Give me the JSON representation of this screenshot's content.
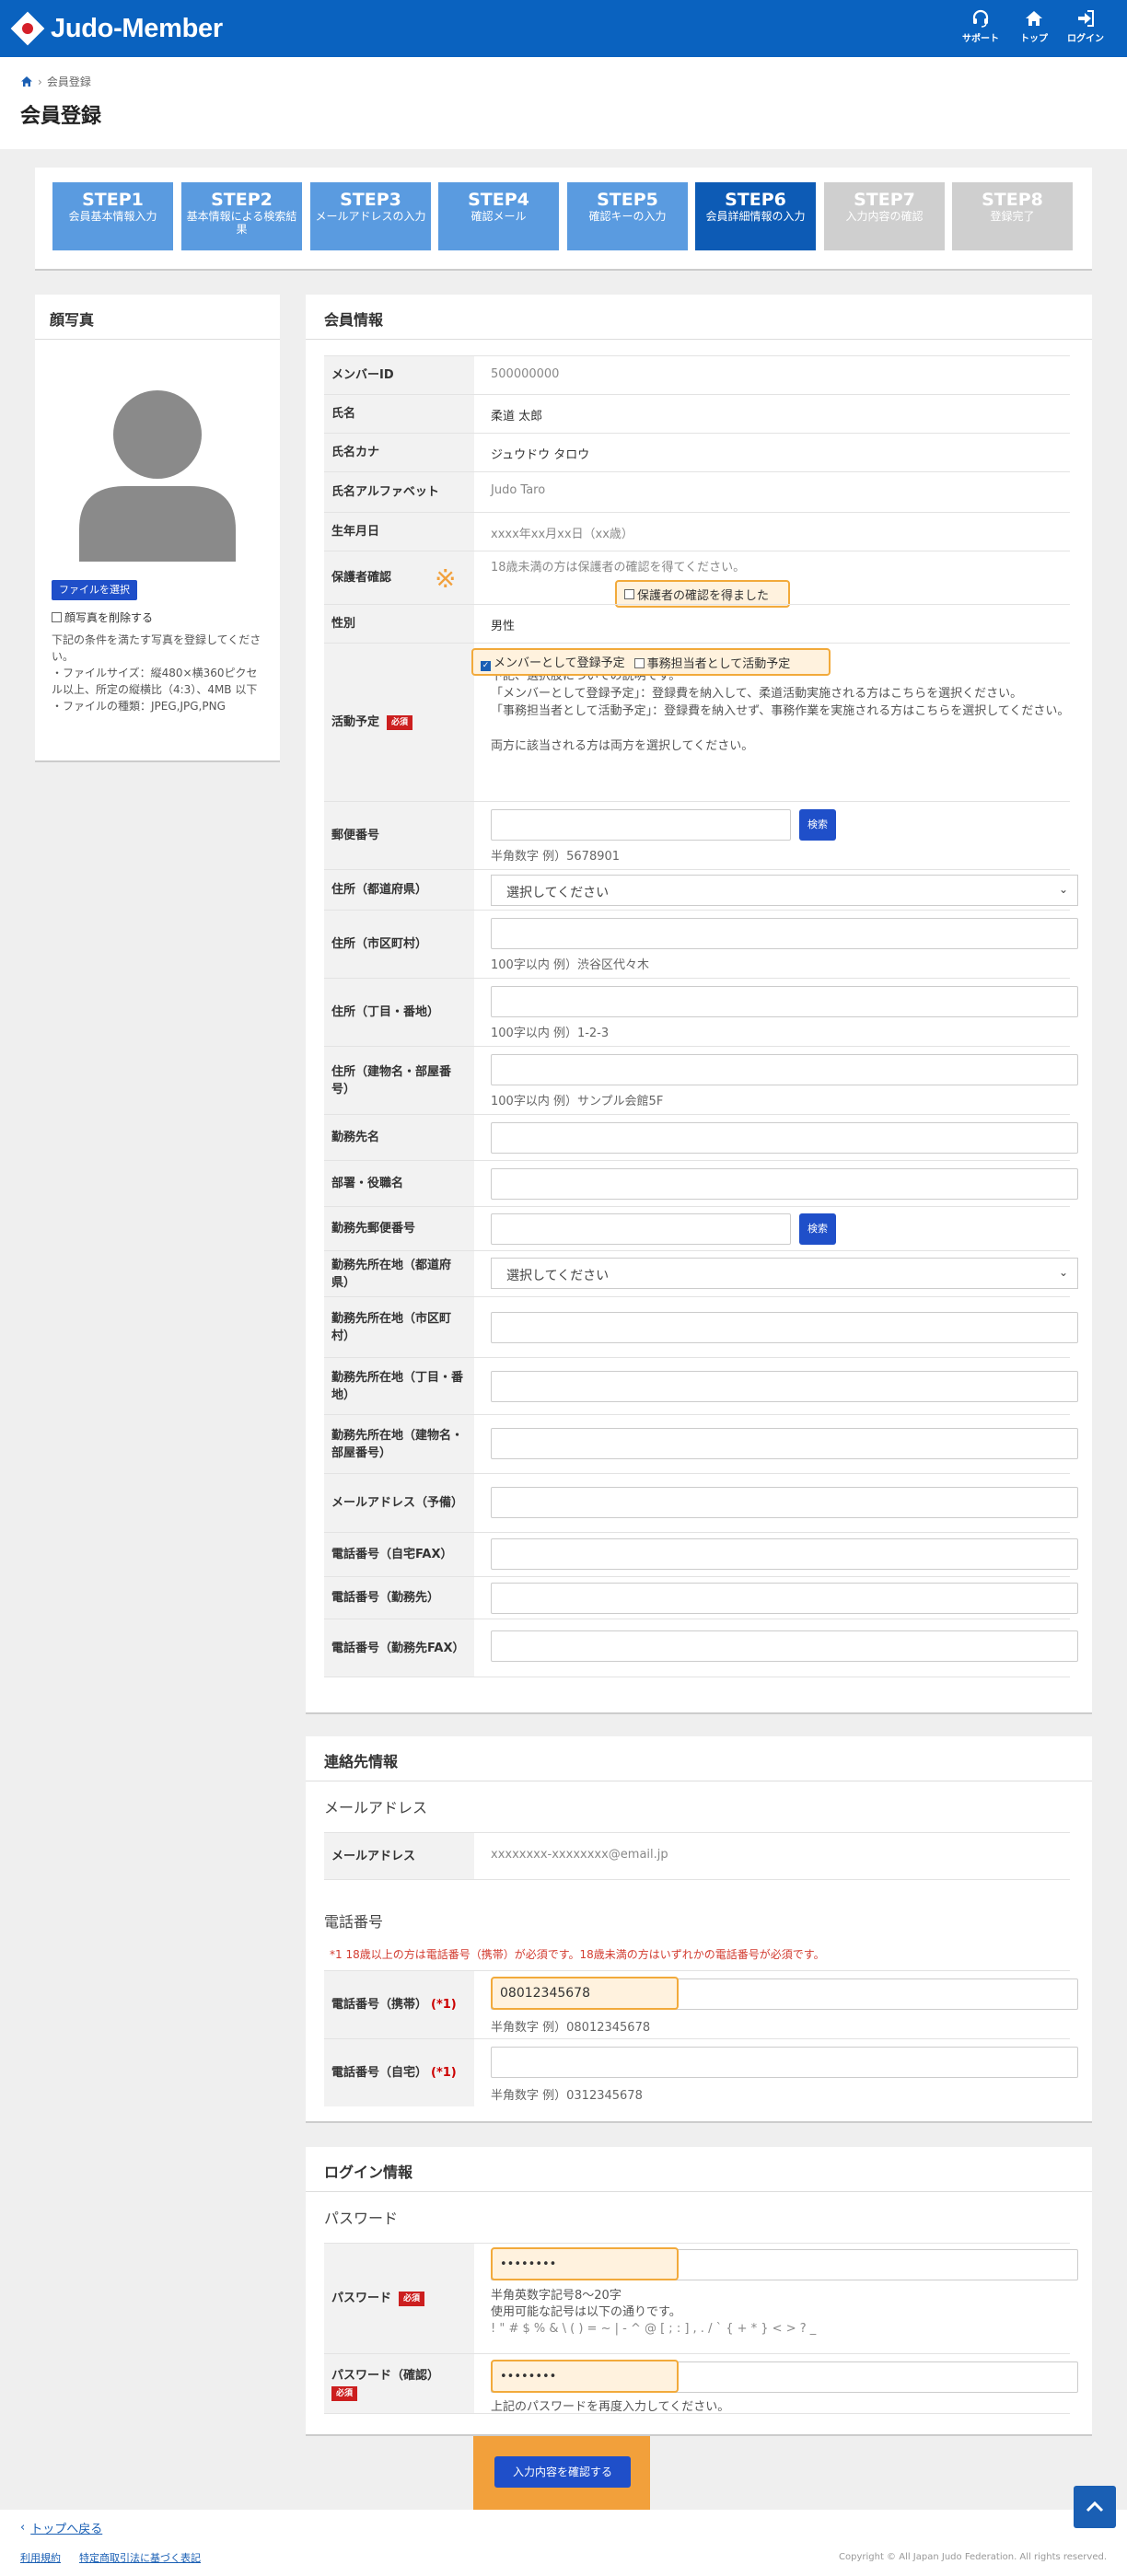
{
  "header": {
    "brand": "Judo-Member",
    "nav": [
      {
        "label": "サポート",
        "icon": "headset-icon"
      },
      {
        "label": "トップ",
        "icon": "home-icon"
      },
      {
        "label": "ログイン",
        "icon": "login-icon"
      }
    ]
  },
  "breadcrumb": {
    "current": "会員登録"
  },
  "page_title": "会員登録",
  "steps": [
    {
      "num": "STEP1",
      "desc": "会員基本情報入力",
      "state": "done"
    },
    {
      "num": "STEP2",
      "desc": "基本情報による検索結果",
      "state": "done"
    },
    {
      "num": "STEP3",
      "desc": "メールアドレスの入力",
      "state": "done"
    },
    {
      "num": "STEP4",
      "desc": "確認メール",
      "state": "done"
    },
    {
      "num": "STEP5",
      "desc": "確認キーの入力",
      "state": "done"
    },
    {
      "num": "STEP6",
      "desc": "会員詳細情報の入力",
      "state": "current"
    },
    {
      "num": "STEP7",
      "desc": "入力内容の確認",
      "state": "todo"
    },
    {
      "num": "STEP8",
      "desc": "登録完了",
      "state": "todo"
    }
  ],
  "colors": {
    "done": "#5a9be0",
    "current": "#0d5bb5",
    "todo": "#cfcfcf",
    "accent": "#f2aa3b"
  },
  "photo": {
    "title": "顔写真",
    "select_button": "ファイルを選択",
    "delete_label": "顔写真を削除する",
    "line1": "下記の条件を満たす写真を登録してください。",
    "line2": "・ファイルサイズ：縦480×横360ピクセル以上、所定の縦横比（4:3）、4MB 以下",
    "line3": "・ファイルの種類：JPEG,JPG,PNG"
  },
  "member": {
    "title": "会員情報",
    "member_id": {
      "label": "メンバーID",
      "value": "500000000"
    },
    "name": {
      "label": "氏名",
      "value": "柔道 太郎"
    },
    "kana": {
      "label": "氏名カナ",
      "value": "ジュウドウ タロウ"
    },
    "alpha": {
      "label": "氏名アルファベット",
      "value": "Judo Taro"
    },
    "birth": {
      "label": "生年月日",
      "value": "xxxx年xx月xx日（xx歳）"
    },
    "guardian": {
      "label": "保護者確認",
      "note": "18歳未満の方は保護者の確認を得てください。",
      "mark": "※",
      "checkbox": "保護者の確認を得ました"
    },
    "gender": {
      "label": "性別",
      "value": "男性"
    },
    "activity": {
      "label": "活動予定",
      "required": "必須",
      "opt1": "メンバーとして登録予定",
      "opt2": "事務担当者として活動予定",
      "d1": "下記、選択肢についての説明です。",
      "d2": "「メンバーとして登録予定」：登録費を納入して、柔道活動実施される方はこちらを選択ください。",
      "d3": "「事務担当者として活動予定」：登録費を納入せず、事務作業を実施される方はこちらを選択してください。",
      "d4": "両方に該当される方は両方を選択してください。"
    },
    "postal": {
      "label": "郵便番号",
      "button": "検索",
      "note": "半角数字 例）5678901"
    },
    "pref": {
      "label": "住所（都道府県）",
      "value": "選択してください"
    },
    "city": {
      "label": "住所（市区町村）",
      "note": "100字以内 例）渋谷区代々木"
    },
    "street": {
      "label": "住所（丁目・番地）",
      "note": "100字以内 例）1-2-3"
    },
    "building": {
      "label": "住所（建物名・部屋番号）",
      "note": "100字以内 例）サンプル会館5F"
    },
    "work_name": {
      "label": "勤務先名"
    },
    "dept": {
      "label": "部署・役職名"
    },
    "work_postal": {
      "label": "勤務先郵便番号",
      "button": "検索"
    },
    "work_pref": {
      "label": "勤務先所在地（都道府県）",
      "value": "選択してください"
    },
    "work_city": {
      "label": "勤務先所在地（市区町村）"
    },
    "work_street": {
      "label": "勤務先所在地（丁目・番地）"
    },
    "work_building": {
      "label": "勤務先所在地（建物名・部屋番号）"
    },
    "email_sub": {
      "label": "メールアドレス（予備）"
    },
    "fax_home": {
      "label": "電話番号（自宅FAX）"
    },
    "tel_work": {
      "label": "電話番号（勤務先）"
    },
    "fax_work": {
      "label": "電話番号（勤務先FAX）"
    }
  },
  "contact": {
    "title": "連絡先情報",
    "email_heading": "メールアドレス",
    "email": {
      "label": "メールアドレス",
      "value": "xxxxxxxx-xxxxxxxx@email.jp"
    },
    "phone_heading": "電話番号",
    "phone_note": "*1 18歳以上の方は電話番号（携帯）が必須です。18歳未満の方はいずれかの電話番号が必須です。",
    "mobile": {
      "label": "電話番号（携帯）",
      "mark": "(*1)",
      "value": "08012345678",
      "note": "半角数字 例）08012345678"
    },
    "home": {
      "label": "電話番号（自宅）",
      "mark": "(*1)",
      "note": "半角数字 例）0312345678"
    }
  },
  "login": {
    "title": "ログイン情報",
    "pw_heading": "パスワード",
    "password": {
      "label": "パスワード",
      "required": "必須",
      "value": "••••••••",
      "note1": "半角英数字記号8～20字",
      "note2": "使用可能な記号は以下の通りです。",
      "note3": "! \" # $ % & \\ ( ) = ~ | - ^ @ [ ; : ] , . / ` { + * } < > ? _"
    },
    "confirm": {
      "label": "パスワード（確認）",
      "required": "必須",
      "value": "••••••••",
      "note": "上記のパスワードを再度入力してください。"
    }
  },
  "submit": "入力内容を確認する",
  "footer": {
    "back": "トップへ戻る",
    "terms": "利用規約",
    "law": "特定商取引法に基づく表記",
    "copyright": "Copyright © All Japan Judo Federation. All rights reserved."
  }
}
